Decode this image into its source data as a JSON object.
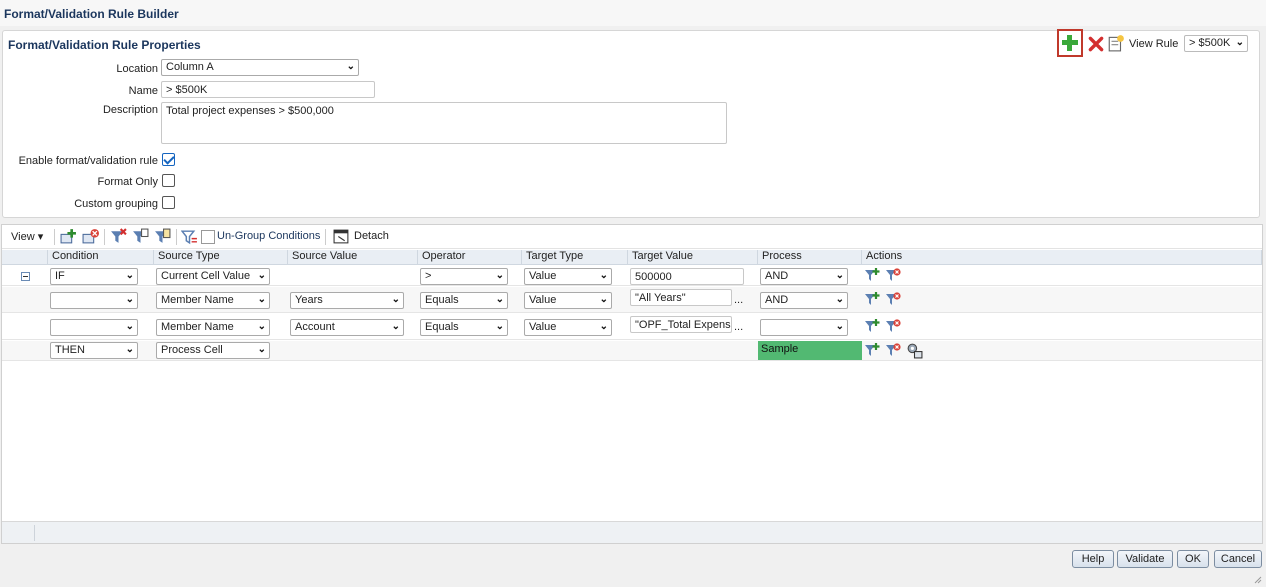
{
  "window": {
    "title": "Format/Validation Rule Builder"
  },
  "props": {
    "title": "Format/Validation Rule Properties",
    "location_label": "Location",
    "location_value": "Column A",
    "name_label": "Name",
    "name_value": "> $500K",
    "description_label": "Description",
    "description_value": "Total project expenses > $500,000",
    "enable_label": "Enable format/validation rule",
    "enable_checked": true,
    "format_only_label": "Format Only",
    "format_only_checked": false,
    "custom_grouping_label": "Custom grouping",
    "custom_grouping_checked": false,
    "view_rule_label": "View Rule",
    "view_rule_value": "> $500K"
  },
  "toolbar": {
    "view_label": "View",
    "ungroup_label": "Un-Group Conditions",
    "detach_label": "Detach"
  },
  "grid": {
    "headers": [
      "Condition",
      "Source Type",
      "Source Value",
      "Operator",
      "Target Type",
      "Target Value",
      "Process",
      "Actions"
    ],
    "rows": [
      {
        "condition": "IF",
        "source_type": "Current Cell Value",
        "source_value": "",
        "operator": ">",
        "target_type": "Value",
        "target_value": "500000",
        "process": "AND"
      },
      {
        "condition": "",
        "source_type": "Member Name",
        "source_value": "Years",
        "operator": "Equals",
        "target_type": "Value",
        "target_value": "\"All Years\"",
        "process": "AND"
      },
      {
        "condition": "",
        "source_type": "Member Name",
        "source_value": "Account",
        "operator": "Equals",
        "target_type": "Value",
        "target_value": "\"OPF_Total Expense",
        "process": ""
      },
      {
        "condition": "THEN",
        "source_type": "Process Cell",
        "source_value": "",
        "operator": "",
        "target_type": "",
        "target_value": "",
        "process": "Sample"
      }
    ],
    "ellipsis": "..."
  },
  "buttons": {
    "help": "Help",
    "validate": "Validate",
    "ok": "OK",
    "cancel": "Cancel"
  },
  "colors": {
    "accent": "#1b365d",
    "sample_fill": "#52b972",
    "add_highlight": "#c0392b"
  }
}
